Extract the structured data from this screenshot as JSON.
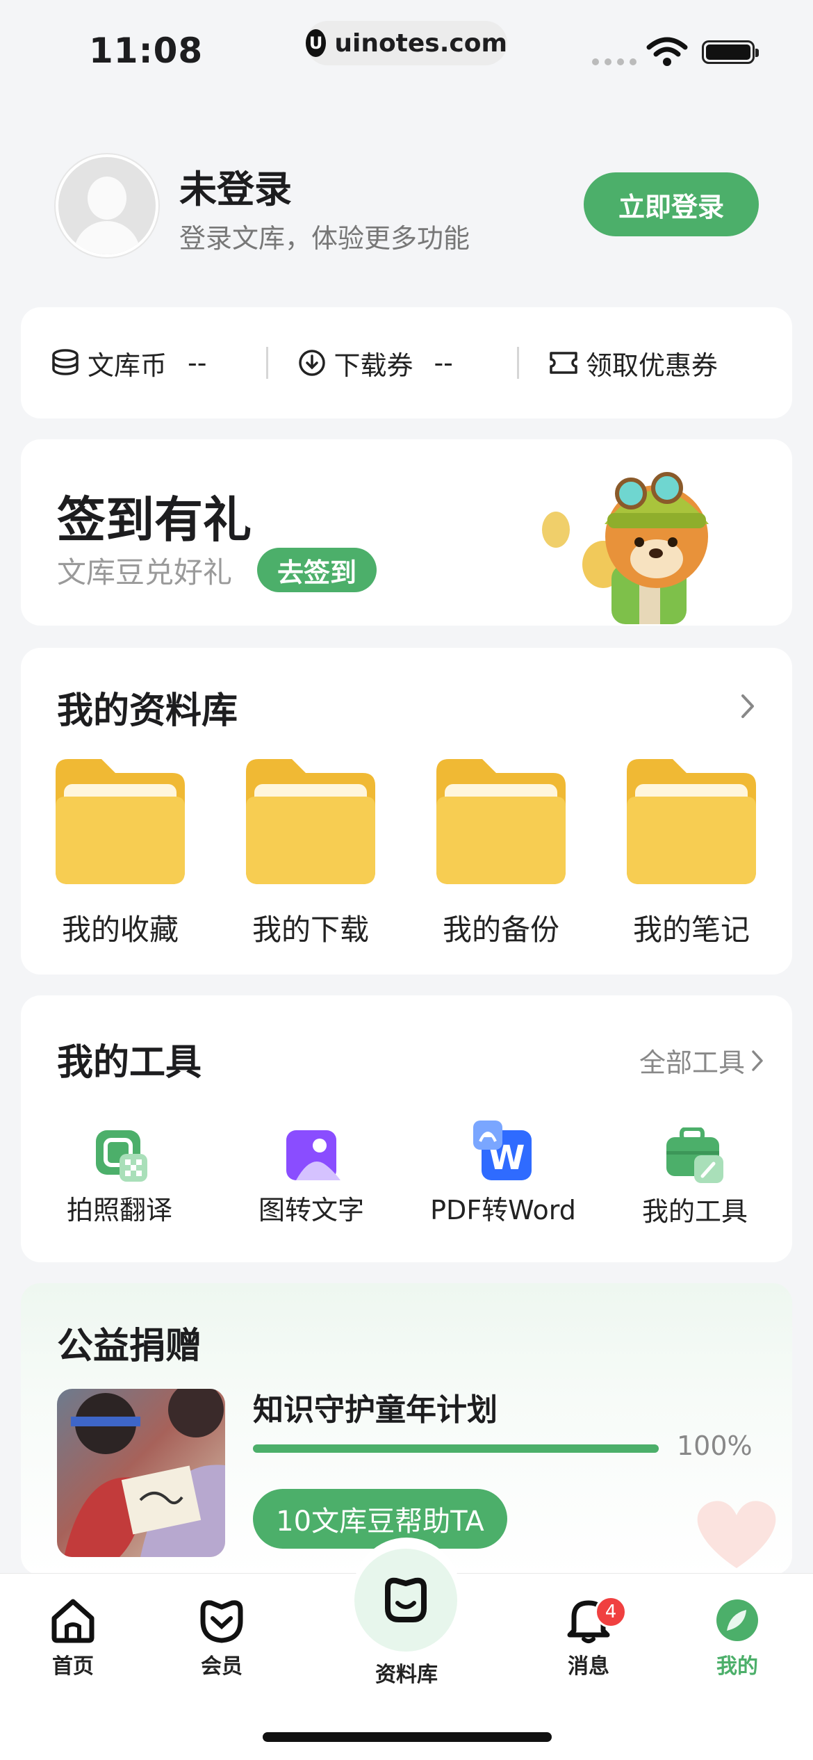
{
  "status_bar": {
    "time": "11:08",
    "url": "uinotes.com"
  },
  "profile": {
    "name": "未登录",
    "subtitle": "登录文库，体验更多功能",
    "login_button": "立即登录"
  },
  "wallet": {
    "coins_label": "文库币",
    "coins_value": "--",
    "vouchers_label": "下载券",
    "vouchers_value": "--",
    "coupon_label": "领取优惠券"
  },
  "signin": {
    "title": "签到有礼",
    "subtitle": "文库豆兑好礼",
    "button": "去签到"
  },
  "library": {
    "title": "我的资料库",
    "items": [
      {
        "label": "我的收藏"
      },
      {
        "label": "我的下载"
      },
      {
        "label": "我的备份"
      },
      {
        "label": "我的笔记"
      }
    ]
  },
  "tools": {
    "title": "我的工具",
    "all_link": "全部工具",
    "items": [
      {
        "label": "拍照翻译",
        "icon": "photo-translate-icon",
        "color": "#4caf6a"
      },
      {
        "label": "图转文字",
        "icon": "image-to-text-icon",
        "color": "#8a4dff"
      },
      {
        "label": "PDF转Word",
        "icon": "pdf-to-word-icon",
        "color": "#2f6bff"
      },
      {
        "label": "我的工具",
        "icon": "toolbox-icon",
        "color": "#4caf6a"
      }
    ]
  },
  "charity": {
    "title": "公益捐赠",
    "project": "知识守护童年计划",
    "progress_percent": 100,
    "progress_label": "100%",
    "donate_button": "10文库豆帮助TA"
  },
  "tabbar": {
    "items": [
      {
        "label": "首页"
      },
      {
        "label": "会员"
      },
      {
        "label": "资料库"
      },
      {
        "label": "消息",
        "badge": "4"
      },
      {
        "label": "我的",
        "active": true
      }
    ]
  },
  "colors": {
    "brand_green": "#4caf6a",
    "folder_yellow": "#f4c84a",
    "badge_red": "#f04040"
  }
}
